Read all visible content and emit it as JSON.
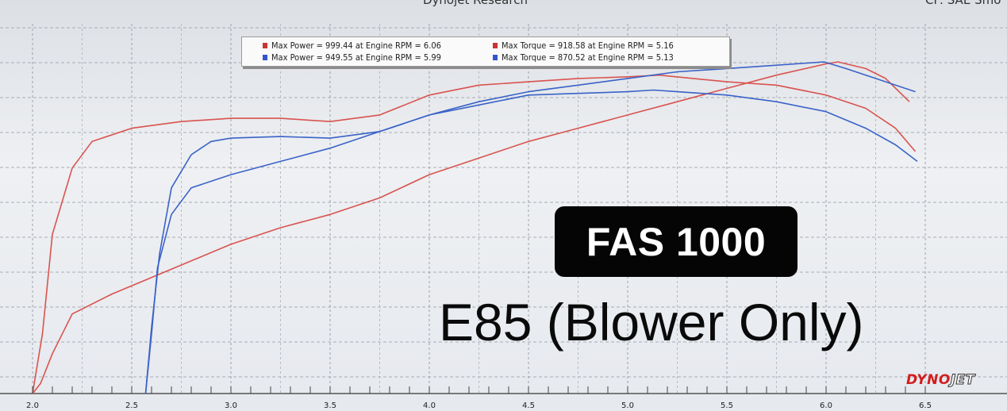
{
  "header": {
    "center_text": "Dynojet Research",
    "right_text": "CF: SAE Smo"
  },
  "legend": {
    "entries": [
      {
        "text": "Max Power = 999.44 at Engine RPM = 6.06",
        "color": "#cc3333"
      },
      {
        "text": "Max Torque = 918.58 at Engine RPM = 5.16",
        "color": "#cc3333"
      },
      {
        "text": "Max Power = 949.55 at Engine RPM = 5.99",
        "color": "#3355cc"
      },
      {
        "text": "Max Torque = 870.52 at Engine RPM = 5.13",
        "color": "#3355cc"
      }
    ]
  },
  "overlay": {
    "title": "FAS 1000",
    "subtitle": "E85 (Blower Only)"
  },
  "logo": {
    "part1": "DYNO",
    "part2": "JET"
  },
  "chart_data": {
    "type": "line",
    "xlabel": "",
    "ylabel": "",
    "xlim": [
      2.0,
      6.5
    ],
    "x_ticks": [
      "2.0",
      "2.5",
      "3.0",
      "3.5",
      "4.0",
      "4.5",
      "5.0",
      "5.5",
      "6.0",
      "6.5"
    ],
    "grid": true,
    "legend_position": "top-center",
    "series": [
      {
        "color": "#d9534f",
        "points": [
          [
            2.0,
            0
          ],
          [
            2.04,
            3
          ],
          [
            2.1,
            12
          ],
          [
            2.2,
            24
          ],
          [
            2.4,
            30
          ],
          [
            2.6,
            35
          ],
          [
            2.8,
            40
          ],
          [
            3.0,
            45
          ],
          [
            3.25,
            50
          ],
          [
            3.5,
            54
          ],
          [
            3.75,
            59
          ],
          [
            4.0,
            66
          ],
          [
            4.25,
            71
          ],
          [
            4.5,
            76
          ],
          [
            4.75,
            80
          ],
          [
            5.0,
            84
          ],
          [
            5.25,
            88
          ],
          [
            5.5,
            92
          ],
          [
            5.75,
            96
          ],
          [
            6.0,
            99.4
          ],
          [
            6.06,
            100
          ],
          [
            6.2,
            98
          ],
          [
            6.3,
            95
          ],
          [
            6.42,
            88
          ]
        ]
      },
      {
        "color": "#d9534f",
        "points": [
          [
            2.0,
            0
          ],
          [
            2.05,
            18
          ],
          [
            2.1,
            48
          ],
          [
            2.2,
            68
          ],
          [
            2.3,
            76
          ],
          [
            2.5,
            80
          ],
          [
            2.75,
            82
          ],
          [
            3.0,
            83
          ],
          [
            3.25,
            83
          ],
          [
            3.5,
            82
          ],
          [
            3.75,
            84
          ],
          [
            4.0,
            90
          ],
          [
            4.25,
            93
          ],
          [
            4.5,
            94
          ],
          [
            4.75,
            95
          ],
          [
            5.0,
            95.5
          ],
          [
            5.16,
            96
          ],
          [
            5.5,
            94
          ],
          [
            5.75,
            93
          ],
          [
            6.0,
            90
          ],
          [
            6.2,
            86
          ],
          [
            6.35,
            80
          ],
          [
            6.45,
            73
          ]
        ]
      },
      {
        "color": "#3a62c8",
        "points": [
          [
            2.57,
            0
          ],
          [
            2.6,
            18
          ],
          [
            2.63,
            38
          ],
          [
            2.7,
            54
          ],
          [
            2.8,
            62
          ],
          [
            3.0,
            66
          ],
          [
            3.25,
            70
          ],
          [
            3.5,
            74
          ],
          [
            3.75,
            79
          ],
          [
            4.0,
            84
          ],
          [
            4.25,
            88
          ],
          [
            4.5,
            91
          ],
          [
            4.75,
            93
          ],
          [
            5.0,
            95
          ],
          [
            5.25,
            97
          ],
          [
            5.5,
            98
          ],
          [
            5.75,
            99
          ],
          [
            5.99,
            100
          ],
          [
            6.1,
            98
          ],
          [
            6.25,
            95
          ],
          [
            6.45,
            91
          ]
        ]
      },
      {
        "color": "#3a62c8",
        "points": [
          [
            2.57,
            0
          ],
          [
            2.6,
            20
          ],
          [
            2.64,
            42
          ],
          [
            2.7,
            62
          ],
          [
            2.8,
            72
          ],
          [
            2.9,
            76
          ],
          [
            3.0,
            77
          ],
          [
            3.25,
            77.5
          ],
          [
            3.5,
            77
          ],
          [
            3.75,
            79
          ],
          [
            4.0,
            84
          ],
          [
            4.25,
            87
          ],
          [
            4.5,
            90
          ],
          [
            4.75,
            90.5
          ],
          [
            5.0,
            91
          ],
          [
            5.13,
            91.5
          ],
          [
            5.25,
            91
          ],
          [
            5.5,
            90
          ],
          [
            5.75,
            88
          ],
          [
            6.0,
            85
          ],
          [
            6.2,
            80
          ],
          [
            6.35,
            75
          ],
          [
            6.46,
            70
          ]
        ]
      }
    ]
  }
}
